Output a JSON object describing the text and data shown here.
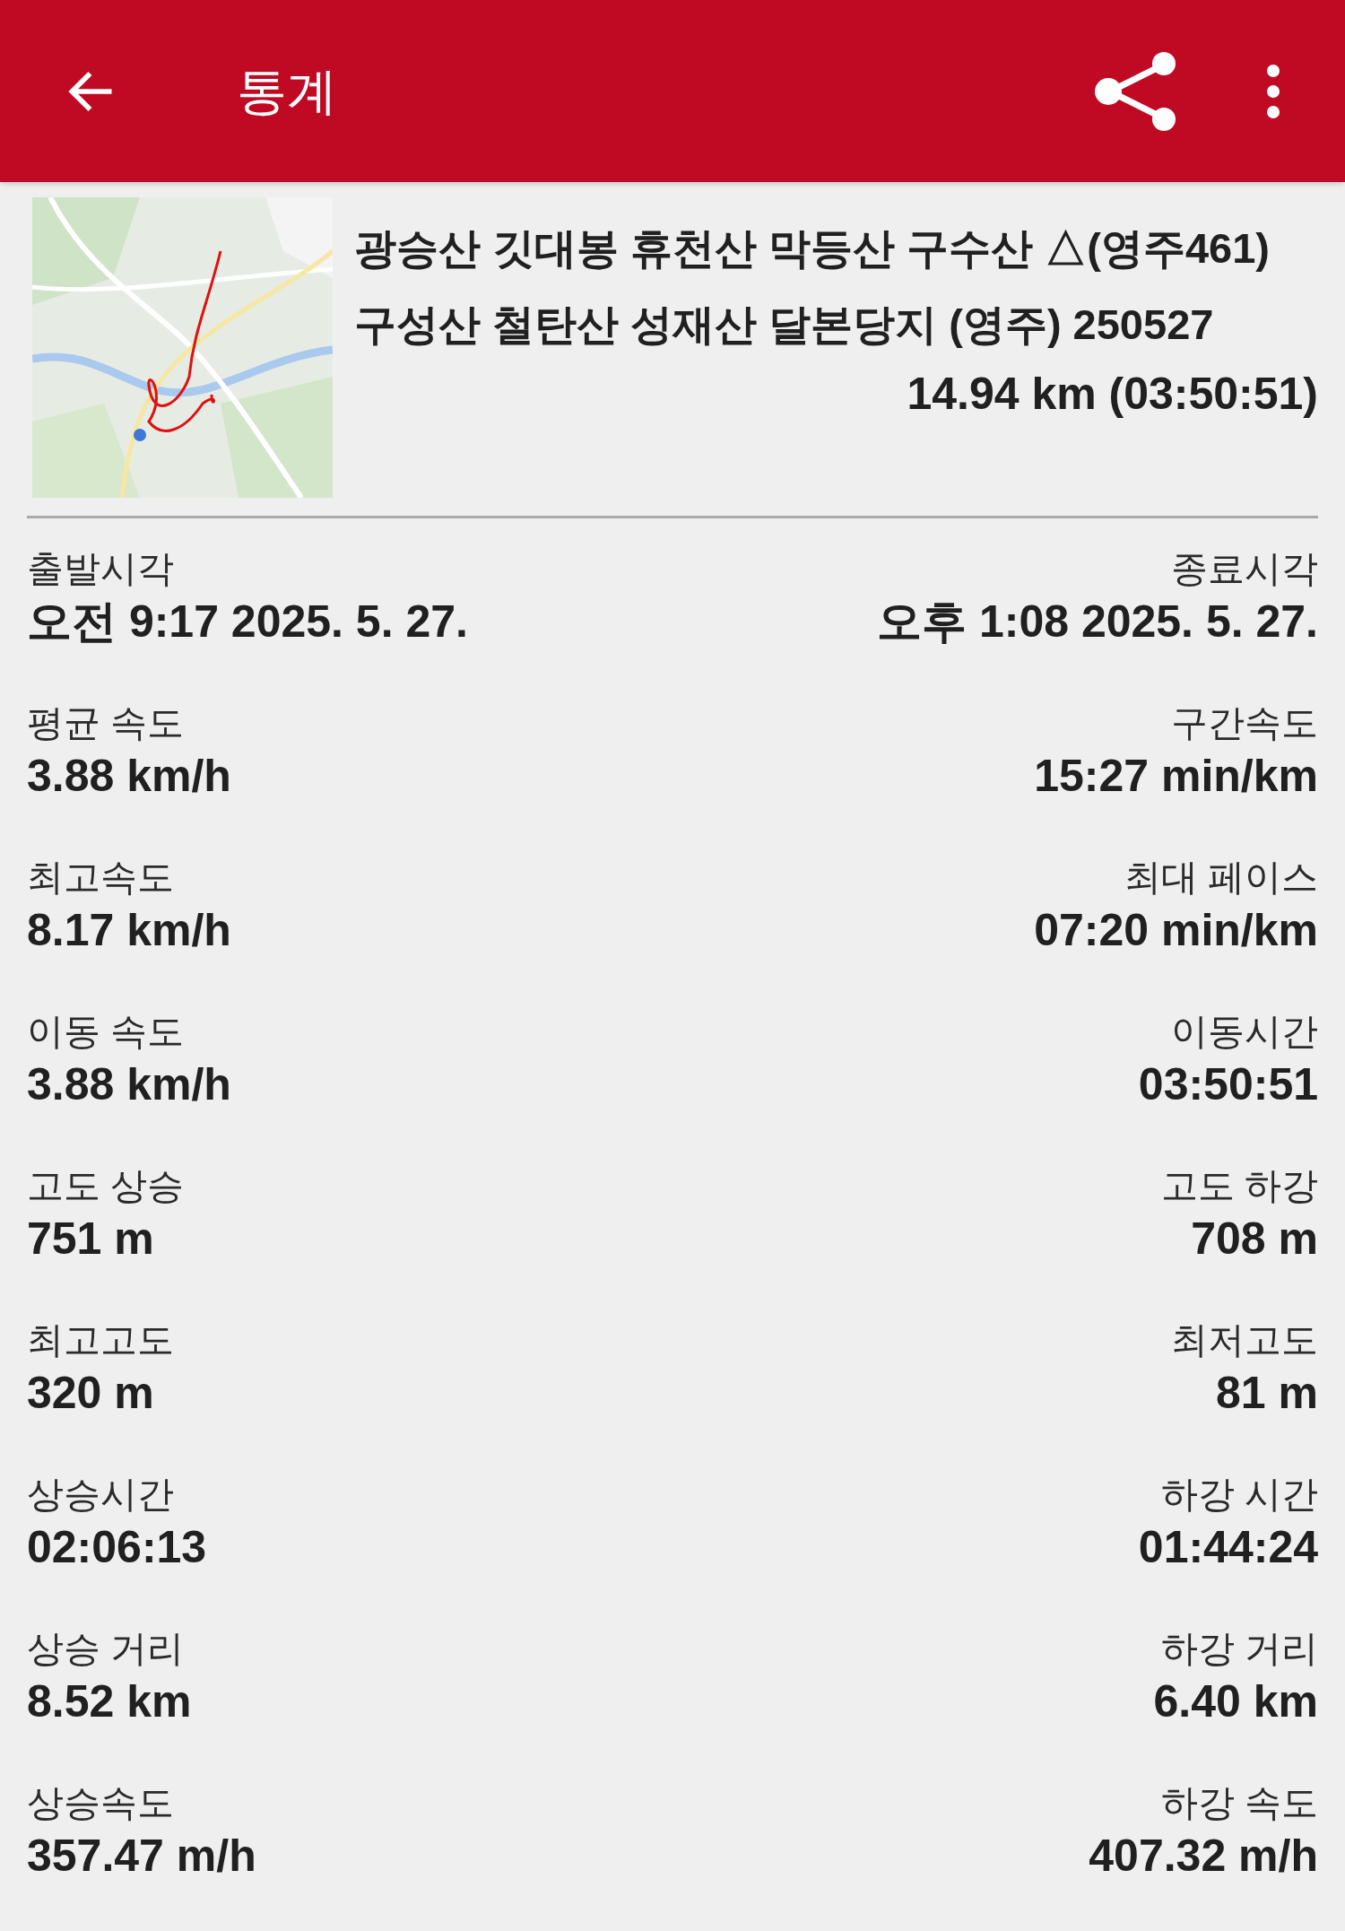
{
  "app_bar": {
    "title": "통계"
  },
  "track": {
    "kind": "picture",
    "name": "광승산 깃대봉 휴천산 막등산 구수산 △(영주461) 구성산 철탄산 성재산 달본당지 (영주) 250527",
    "summary": "14.94 km (03:50:51)"
  },
  "stats": [
    {
      "left": {
        "label": "출발시각",
        "value": "오전 9:17 2025. 5. 27."
      },
      "right": {
        "label": "종료시각",
        "value": "오후 1:08 2025. 5. 27."
      }
    },
    {
      "left": {
        "label": "평균 속도",
        "value": "3.88 km/h"
      },
      "right": {
        "label": "구간속도",
        "value": "15:27 min/km"
      }
    },
    {
      "left": {
        "label": "최고속도",
        "value": "8.17 km/h"
      },
      "right": {
        "label": "최대 페이스",
        "value": "07:20 min/km"
      }
    },
    {
      "left": {
        "label": "이동 속도",
        "value": "3.88 km/h"
      },
      "right": {
        "label": "이동시간",
        "value": "03:50:51"
      }
    },
    {
      "left": {
        "label": "고도 상승",
        "value": "751 m"
      },
      "right": {
        "label": "고도 하강",
        "value": "708 m"
      }
    },
    {
      "left": {
        "label": "최고고도",
        "value": "320 m"
      },
      "right": {
        "label": "최저고도",
        "value": "81 m"
      }
    },
    {
      "left": {
        "label": "상승시간",
        "value": "02:06:13"
      },
      "right": {
        "label": "하강 시간",
        "value": "01:44:24"
      }
    },
    {
      "left": {
        "label": "상승 거리",
        "value": "8.52 km"
      },
      "right": {
        "label": "하강 거리",
        "value": "6.40 km"
      }
    },
    {
      "left": {
        "label": "상승속도",
        "value": "357.47 m/h"
      },
      "right": {
        "label": "하강 속도",
        "value": "407.32 m/h"
      }
    }
  ]
}
